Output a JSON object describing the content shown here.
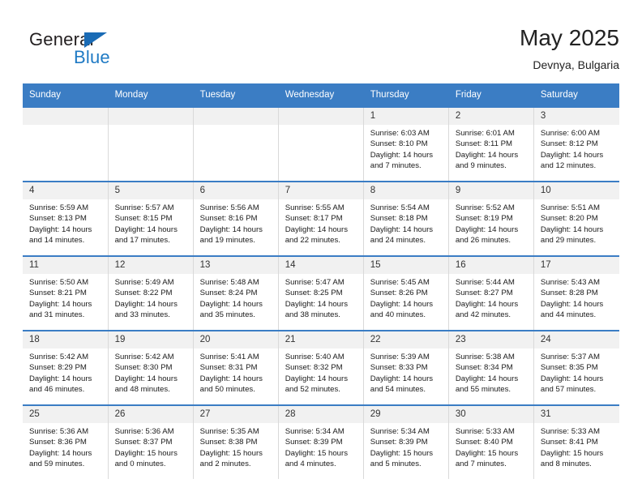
{
  "brand": {
    "name_top": "General",
    "name_bottom": "Blue",
    "accent_color": "#1f7ac4",
    "triangle_color": "#1a6bb5"
  },
  "header": {
    "title": "May 2025",
    "location": "Devnya, Bulgaria"
  },
  "theme": {
    "header_bg": "#3b7dc4",
    "header_text": "#ffffff",
    "daynum_bg": "#f1f1f1",
    "row_divider": "#3b7dc4",
    "cell_divider": "#d9d9d9"
  },
  "weekday_headers": [
    "Sunday",
    "Monday",
    "Tuesday",
    "Wednesday",
    "Thursday",
    "Friday",
    "Saturday"
  ],
  "weeks": [
    [
      {
        "day": "",
        "empty": true,
        "sunrise": "",
        "sunset": "",
        "daylight_line1": "",
        "daylight_line2": ""
      },
      {
        "day": "",
        "empty": true,
        "sunrise": "",
        "sunset": "",
        "daylight_line1": "",
        "daylight_line2": ""
      },
      {
        "day": "",
        "empty": true,
        "sunrise": "",
        "sunset": "",
        "daylight_line1": "",
        "daylight_line2": ""
      },
      {
        "day": "",
        "empty": true,
        "sunrise": "",
        "sunset": "",
        "daylight_line1": "",
        "daylight_line2": ""
      },
      {
        "day": "1",
        "sunrise": "Sunrise: 6:03 AM",
        "sunset": "Sunset: 8:10 PM",
        "daylight_line1": "Daylight: 14 hours",
        "daylight_line2": "and 7 minutes."
      },
      {
        "day": "2",
        "sunrise": "Sunrise: 6:01 AM",
        "sunset": "Sunset: 8:11 PM",
        "daylight_line1": "Daylight: 14 hours",
        "daylight_line2": "and 9 minutes."
      },
      {
        "day": "3",
        "sunrise": "Sunrise: 6:00 AM",
        "sunset": "Sunset: 8:12 PM",
        "daylight_line1": "Daylight: 14 hours",
        "daylight_line2": "and 12 minutes."
      }
    ],
    [
      {
        "day": "4",
        "sunrise": "Sunrise: 5:59 AM",
        "sunset": "Sunset: 8:13 PM",
        "daylight_line1": "Daylight: 14 hours",
        "daylight_line2": "and 14 minutes."
      },
      {
        "day": "5",
        "sunrise": "Sunrise: 5:57 AM",
        "sunset": "Sunset: 8:15 PM",
        "daylight_line1": "Daylight: 14 hours",
        "daylight_line2": "and 17 minutes."
      },
      {
        "day": "6",
        "sunrise": "Sunrise: 5:56 AM",
        "sunset": "Sunset: 8:16 PM",
        "daylight_line1": "Daylight: 14 hours",
        "daylight_line2": "and 19 minutes."
      },
      {
        "day": "7",
        "sunrise": "Sunrise: 5:55 AM",
        "sunset": "Sunset: 8:17 PM",
        "daylight_line1": "Daylight: 14 hours",
        "daylight_line2": "and 22 minutes."
      },
      {
        "day": "8",
        "sunrise": "Sunrise: 5:54 AM",
        "sunset": "Sunset: 8:18 PM",
        "daylight_line1": "Daylight: 14 hours",
        "daylight_line2": "and 24 minutes."
      },
      {
        "day": "9",
        "sunrise": "Sunrise: 5:52 AM",
        "sunset": "Sunset: 8:19 PM",
        "daylight_line1": "Daylight: 14 hours",
        "daylight_line2": "and 26 minutes."
      },
      {
        "day": "10",
        "sunrise": "Sunrise: 5:51 AM",
        "sunset": "Sunset: 8:20 PM",
        "daylight_line1": "Daylight: 14 hours",
        "daylight_line2": "and 29 minutes."
      }
    ],
    [
      {
        "day": "11",
        "sunrise": "Sunrise: 5:50 AM",
        "sunset": "Sunset: 8:21 PM",
        "daylight_line1": "Daylight: 14 hours",
        "daylight_line2": "and 31 minutes."
      },
      {
        "day": "12",
        "sunrise": "Sunrise: 5:49 AM",
        "sunset": "Sunset: 8:22 PM",
        "daylight_line1": "Daylight: 14 hours",
        "daylight_line2": "and 33 minutes."
      },
      {
        "day": "13",
        "sunrise": "Sunrise: 5:48 AM",
        "sunset": "Sunset: 8:24 PM",
        "daylight_line1": "Daylight: 14 hours",
        "daylight_line2": "and 35 minutes."
      },
      {
        "day": "14",
        "sunrise": "Sunrise: 5:47 AM",
        "sunset": "Sunset: 8:25 PM",
        "daylight_line1": "Daylight: 14 hours",
        "daylight_line2": "and 38 minutes."
      },
      {
        "day": "15",
        "sunrise": "Sunrise: 5:45 AM",
        "sunset": "Sunset: 8:26 PM",
        "daylight_line1": "Daylight: 14 hours",
        "daylight_line2": "and 40 minutes."
      },
      {
        "day": "16",
        "sunrise": "Sunrise: 5:44 AM",
        "sunset": "Sunset: 8:27 PM",
        "daylight_line1": "Daylight: 14 hours",
        "daylight_line2": "and 42 minutes."
      },
      {
        "day": "17",
        "sunrise": "Sunrise: 5:43 AM",
        "sunset": "Sunset: 8:28 PM",
        "daylight_line1": "Daylight: 14 hours",
        "daylight_line2": "and 44 minutes."
      }
    ],
    [
      {
        "day": "18",
        "sunrise": "Sunrise: 5:42 AM",
        "sunset": "Sunset: 8:29 PM",
        "daylight_line1": "Daylight: 14 hours",
        "daylight_line2": "and 46 minutes."
      },
      {
        "day": "19",
        "sunrise": "Sunrise: 5:42 AM",
        "sunset": "Sunset: 8:30 PM",
        "daylight_line1": "Daylight: 14 hours",
        "daylight_line2": "and 48 minutes."
      },
      {
        "day": "20",
        "sunrise": "Sunrise: 5:41 AM",
        "sunset": "Sunset: 8:31 PM",
        "daylight_line1": "Daylight: 14 hours",
        "daylight_line2": "and 50 minutes."
      },
      {
        "day": "21",
        "sunrise": "Sunrise: 5:40 AM",
        "sunset": "Sunset: 8:32 PM",
        "daylight_line1": "Daylight: 14 hours",
        "daylight_line2": "and 52 minutes."
      },
      {
        "day": "22",
        "sunrise": "Sunrise: 5:39 AM",
        "sunset": "Sunset: 8:33 PM",
        "daylight_line1": "Daylight: 14 hours",
        "daylight_line2": "and 54 minutes."
      },
      {
        "day": "23",
        "sunrise": "Sunrise: 5:38 AM",
        "sunset": "Sunset: 8:34 PM",
        "daylight_line1": "Daylight: 14 hours",
        "daylight_line2": "and 55 minutes."
      },
      {
        "day": "24",
        "sunrise": "Sunrise: 5:37 AM",
        "sunset": "Sunset: 8:35 PM",
        "daylight_line1": "Daylight: 14 hours",
        "daylight_line2": "and 57 minutes."
      }
    ],
    [
      {
        "day": "25",
        "sunrise": "Sunrise: 5:36 AM",
        "sunset": "Sunset: 8:36 PM",
        "daylight_line1": "Daylight: 14 hours",
        "daylight_line2": "and 59 minutes."
      },
      {
        "day": "26",
        "sunrise": "Sunrise: 5:36 AM",
        "sunset": "Sunset: 8:37 PM",
        "daylight_line1": "Daylight: 15 hours",
        "daylight_line2": "and 0 minutes."
      },
      {
        "day": "27",
        "sunrise": "Sunrise: 5:35 AM",
        "sunset": "Sunset: 8:38 PM",
        "daylight_line1": "Daylight: 15 hours",
        "daylight_line2": "and 2 minutes."
      },
      {
        "day": "28",
        "sunrise": "Sunrise: 5:34 AM",
        "sunset": "Sunset: 8:39 PM",
        "daylight_line1": "Daylight: 15 hours",
        "daylight_line2": "and 4 minutes."
      },
      {
        "day": "29",
        "sunrise": "Sunrise: 5:34 AM",
        "sunset": "Sunset: 8:39 PM",
        "daylight_line1": "Daylight: 15 hours",
        "daylight_line2": "and 5 minutes."
      },
      {
        "day": "30",
        "sunrise": "Sunrise: 5:33 AM",
        "sunset": "Sunset: 8:40 PM",
        "daylight_line1": "Daylight: 15 hours",
        "daylight_line2": "and 7 minutes."
      },
      {
        "day": "31",
        "sunrise": "Sunrise: 5:33 AM",
        "sunset": "Sunset: 8:41 PM",
        "daylight_line1": "Daylight: 15 hours",
        "daylight_line2": "and 8 minutes."
      }
    ]
  ]
}
